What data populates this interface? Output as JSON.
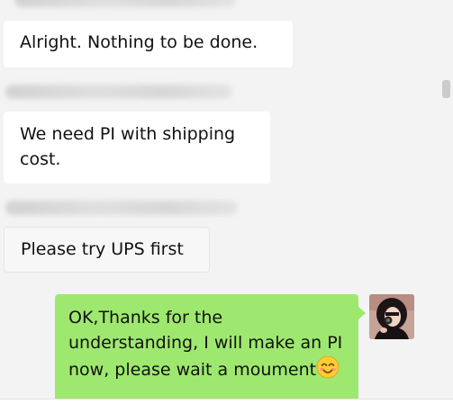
{
  "messages": [
    {
      "direction": "incoming",
      "text": "Alright. Nothing to be done."
    },
    {
      "direction": "incoming",
      "text": "We need PI with shipping cost."
    },
    {
      "direction": "incoming",
      "text": "Please try UPS first"
    },
    {
      "direction": "outgoing",
      "text": "OK,Thanks for the understanding, I will make an PI now, please wait a moument",
      "emoji": "smiling-face-icon"
    }
  ],
  "colors": {
    "background": "#f3f3f3",
    "incoming_bubble": "#ffffff",
    "outgoing_bubble": "#9fe870"
  }
}
